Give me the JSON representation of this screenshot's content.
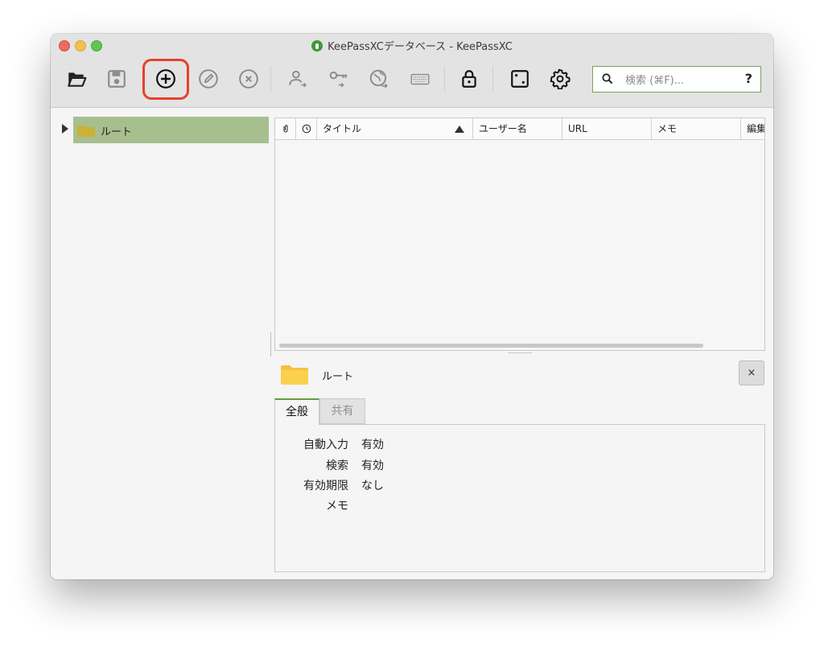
{
  "window": {
    "title": "KeePassXCデータベース - KeePassXC"
  },
  "toolbar": {
    "buttons": [
      {
        "name": "open-database",
        "icon": "folder-open-icon",
        "enabled": true
      },
      {
        "name": "save-database",
        "icon": "save-icon",
        "enabled": false
      },
      {
        "name": "add-entry",
        "icon": "plus-circle-icon",
        "enabled": true,
        "highlighted": true
      },
      {
        "name": "edit-entry",
        "icon": "pencil-circle-icon",
        "enabled": false
      },
      {
        "name": "delete-entry",
        "icon": "x-circle-icon",
        "enabled": false
      },
      {
        "name": "copy-username",
        "icon": "user-copy-icon",
        "enabled": false
      },
      {
        "name": "copy-password",
        "icon": "key-copy-icon",
        "enabled": false
      },
      {
        "name": "copy-url",
        "icon": "globe-copy-icon",
        "enabled": false
      },
      {
        "name": "autotype",
        "icon": "keyboard-icon",
        "enabled": false
      },
      {
        "name": "lock-database",
        "icon": "lock-icon",
        "enabled": true
      },
      {
        "name": "password-generator",
        "icon": "dice-icon",
        "enabled": true
      },
      {
        "name": "settings",
        "icon": "gear-icon",
        "enabled": true
      }
    ],
    "highlight_color": "#e8402c"
  },
  "search": {
    "placeholder": "検索 (⌘F)...",
    "value": "",
    "help_label": "?"
  },
  "groups": {
    "root_label": "ルート",
    "selected_color": "#a7bf8f"
  },
  "entries_table": {
    "columns": [
      "",
      "",
      "タイトル",
      "ユーザー名",
      "URL",
      "メモ",
      "編集"
    ],
    "sorted_column": "タイトル",
    "sort_order": "ascending",
    "rows": []
  },
  "details": {
    "group_title": "ルート",
    "close_label": "×",
    "tabs": [
      {
        "label": "全般",
        "active": true
      },
      {
        "label": "共有",
        "active": false
      }
    ],
    "properties": [
      {
        "label": "自動入力",
        "value": "有効"
      },
      {
        "label": "検索",
        "value": "有効"
      },
      {
        "label": "有効期限",
        "value": "なし"
      },
      {
        "label": "メモ",
        "value": ""
      }
    ]
  }
}
